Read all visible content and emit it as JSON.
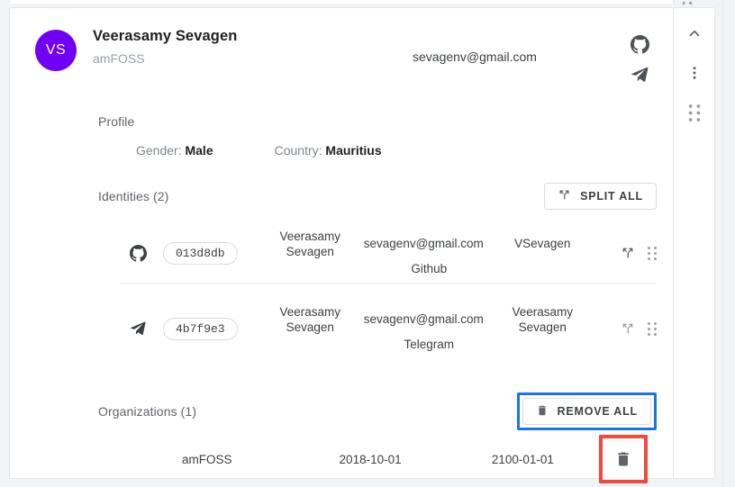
{
  "colors": {
    "avatar_bg": "#7000f5",
    "annotation_blue": "#1a73e8",
    "annotation_red": "#f4483c",
    "page_bg": "#f1f3f4",
    "card_bg": "#ffffff"
  },
  "header": {
    "avatar_initials": "VS",
    "name": "Veerasamy Sevagen",
    "organization": "amFOSS",
    "email": "sevagenv@gmail.com",
    "icons": [
      "github-icon",
      "telegram-icon"
    ],
    "rail": [
      "chevron-up-icon",
      "more-vertical-icon",
      "drag-handle-icon"
    ]
  },
  "profile": {
    "title": "Profile",
    "fields": [
      {
        "label": "Gender:",
        "value": "Male"
      },
      {
        "label": "Country:",
        "value": "Mauritius"
      }
    ]
  },
  "identities": {
    "title": "Identities (2)",
    "split_all_label": "SPLIT ALL",
    "rows": [
      {
        "source_icon": "github-icon",
        "uuid": "013d8db",
        "name": "Veerasamy Sevagen",
        "email": "sevagenv@gmail.com",
        "username": "VSevagen",
        "source": "Github"
      },
      {
        "source_icon": "telegram-icon",
        "uuid": "4b7f9e3",
        "name": "Veerasamy Sevagen",
        "email": "sevagenv@gmail.com",
        "username": "Veerasamy Sevagen",
        "source": "Telegram"
      }
    ]
  },
  "organizations": {
    "title": "Organizations (1)",
    "remove_all_label": "REMOVE ALL",
    "rows": [
      {
        "name": "amFOSS",
        "from_date": "2018-10-01",
        "to_date": "2100-01-01"
      }
    ]
  }
}
